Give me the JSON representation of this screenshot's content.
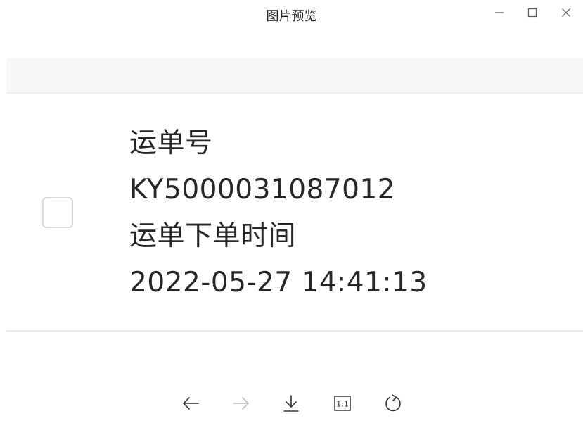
{
  "window": {
    "title": "图片预览",
    "controls": {
      "minimize": "minimize-icon",
      "maximize": "maximize-icon",
      "close": "close-icon"
    }
  },
  "image": {
    "lines": [
      "运单号",
      "KY5000031087012",
      "运单下单时间",
      "2022-05-27 14:41:13"
    ],
    "checkbox_checked": false
  },
  "toolbar": {
    "previous": {
      "icon": "arrow-left-icon",
      "enabled": true
    },
    "next": {
      "icon": "arrow-right-icon",
      "enabled": false
    },
    "download": {
      "icon": "download-icon",
      "enabled": true
    },
    "actual_size": {
      "icon": "actual-size-icon",
      "label": "1:1",
      "enabled": true
    },
    "rotate": {
      "icon": "rotate-icon",
      "enabled": true
    }
  },
  "colors": {
    "icon": "#333333",
    "icon_disabled": "#bfbfbf",
    "text": "#262626",
    "divider": "#ececec"
  }
}
